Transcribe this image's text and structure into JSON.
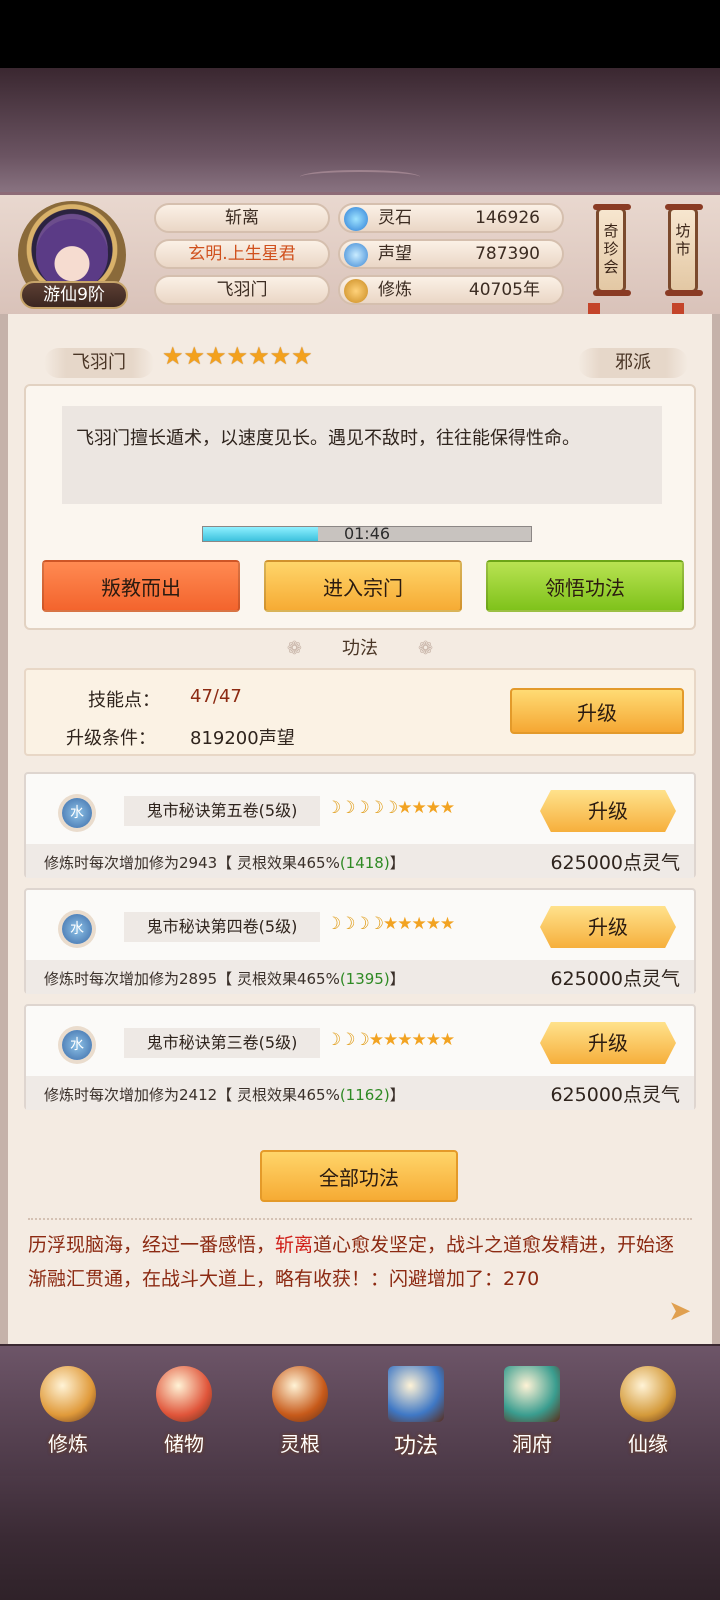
{
  "player": {
    "rank": "游仙9阶",
    "name": "斩离",
    "title": "玄明.上生星君",
    "sect": "飞羽门"
  },
  "resources": [
    {
      "label": "灵石",
      "value": "146926",
      "icon": "crystal-icon"
    },
    {
      "label": "声望",
      "value": "787390",
      "icon": "flame-icon"
    },
    {
      "label": "修炼",
      "value": "40705年",
      "icon": "meditation-icon"
    }
  ],
  "side_buttons": {
    "treasure": "奇珍会",
    "market": "坊市"
  },
  "sect_panel": {
    "name": "飞羽门",
    "stars": "★★★★★★★",
    "star_count": 7,
    "faction": "邪派",
    "description": "飞羽门擅长遁术，以速度见长。遇见不敌时，往往能保得性命。",
    "timer": "01:46",
    "progress": 0.35,
    "buttons": {
      "betray": "叛教而出",
      "enter": "进入宗门",
      "comprehend": "领悟功法"
    }
  },
  "skills": {
    "title": "功法",
    "skill_points_label": "技能点：",
    "skill_points_value": "47/47",
    "upgrade_cond_label": "升级条件：",
    "upgrade_cond_value": "819200声望",
    "upgrade_label": "升级",
    "techniques": [
      {
        "element": "水",
        "name": "鬼市秘诀第五卷(5级)",
        "moons": "☽☽☽☽☽",
        "stars": "★★★★",
        "effect_prefix": "修炼时每次增加修为2943【 灵根效果465%",
        "effect_bonus": "(1418)",
        "effect_suffix": "】",
        "button": "升级",
        "cost": "625000点灵气"
      },
      {
        "element": "水",
        "name": "鬼市秘诀第四卷(5级)",
        "moons": "☽☽☽☽",
        "stars": "★★★★★",
        "effect_prefix": "修炼时每次增加修为2895【 灵根效果465%",
        "effect_bonus": "(1395)",
        "effect_suffix": "】",
        "button": "升级",
        "cost": "625000点灵气"
      },
      {
        "element": "水",
        "name": "鬼市秘诀第三卷(5级)",
        "moons": "☽☽☽",
        "stars": "★★★★★★",
        "effect_prefix": "修炼时每次增加修为2412【 灵根效果465%",
        "effect_bonus": "(1162)",
        "effect_suffix": "】",
        "button": "升级",
        "cost": "625000点灵气"
      }
    ],
    "all_button": "全部功法"
  },
  "log": {
    "part1": "历浮现脑海，经过一番感悟，",
    "highlight": "斩离",
    "part2": "道心愈发坚定，战斗之道愈发精进，开始逐渐融汇贯通，在战斗大道上，略有收获！：闪避增加了：270"
  },
  "nav": [
    {
      "label": "修炼",
      "icon": "cultivate-icon",
      "color": "#e09a3a"
    },
    {
      "label": "储物",
      "icon": "bag-icon",
      "color": "#e0553a"
    },
    {
      "label": "灵根",
      "icon": "spirit-root-icon",
      "color": "#c75a1a"
    },
    {
      "label": "功法",
      "icon": "book-icon",
      "color": "#3f78c5"
    },
    {
      "label": "洞府",
      "icon": "cave-icon",
      "color": "#3a9d8f"
    },
    {
      "label": "仙缘",
      "icon": "gourd-icon",
      "color": "#d49a3a"
    }
  ]
}
